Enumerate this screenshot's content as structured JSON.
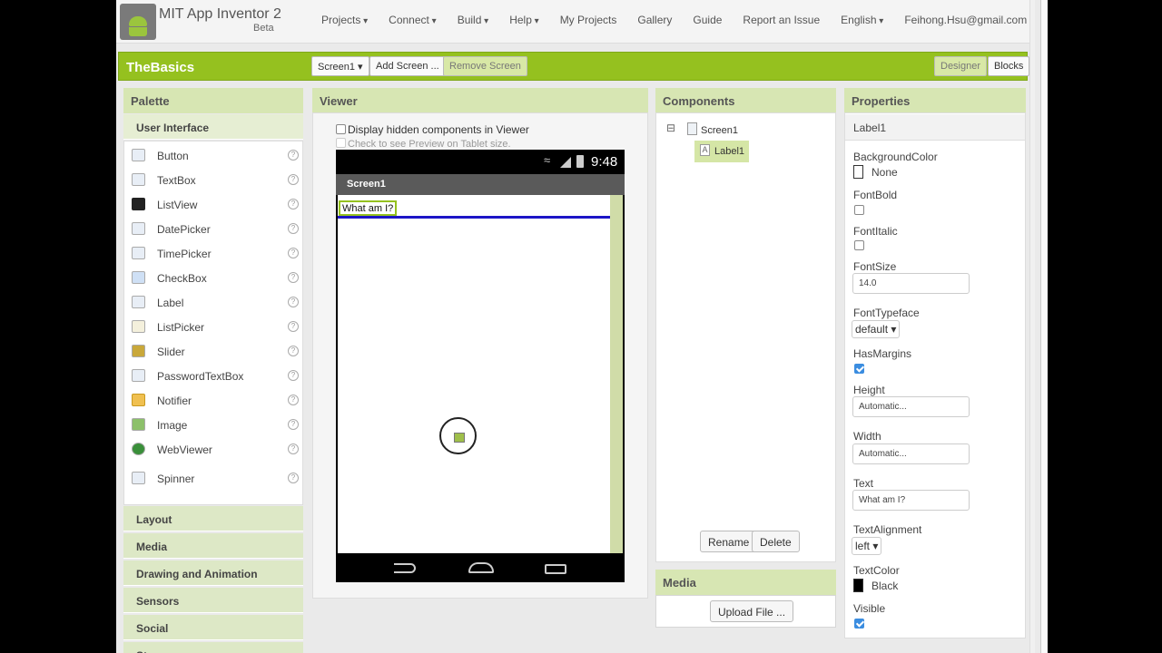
{
  "app": {
    "title": "MIT App Inventor 2",
    "badge": "Beta"
  },
  "nav": [
    "Projects",
    "Connect",
    "Build",
    "Help",
    "My Projects",
    "Gallery",
    "Guide",
    "Report an Issue",
    "English",
    "Feihong.Hsu@gmail.com"
  ],
  "project": {
    "name": "TheBasics",
    "screen_select": "Screen1",
    "add_screen": "Add Screen ...",
    "remove_screen": "Remove Screen",
    "designer": "Designer",
    "blocks": "Blocks"
  },
  "palette": {
    "title": "Palette",
    "section": "User Interface",
    "items": [
      {
        "label": "Button",
        "icon": "button-icon"
      },
      {
        "label": "TextBox",
        "icon": "textbox-icon"
      },
      {
        "label": "ListView",
        "icon": "listview-icon"
      },
      {
        "label": "DatePicker",
        "icon": "datepicker-icon"
      },
      {
        "label": "TimePicker",
        "icon": "timepicker-icon"
      },
      {
        "label": "CheckBox",
        "icon": "checkbox-icon"
      },
      {
        "label": "Label",
        "icon": "label-icon"
      },
      {
        "label": "ListPicker",
        "icon": "listpicker-icon"
      },
      {
        "label": "Slider",
        "icon": "slider-icon"
      },
      {
        "label": "PasswordTextBox",
        "icon": "passwordtextbox-icon"
      },
      {
        "label": "Notifier",
        "icon": "notifier-icon"
      },
      {
        "label": "Image",
        "icon": "image-icon"
      },
      {
        "label": "WebViewer",
        "icon": "webviewer-icon"
      },
      {
        "label": "Spinner",
        "icon": "spinner-icon"
      }
    ],
    "help_glyph": "?",
    "categories": [
      "Layout",
      "Media",
      "Drawing and Animation",
      "Sensors",
      "Social",
      "St"
    ]
  },
  "viewer": {
    "title": "Viewer",
    "show_hidden": "Display hidden components in Viewer",
    "tablet_preview": "Check to see Preview on Tablet size.",
    "time": "9:48",
    "screen_title": "Screen1",
    "label_text": "What am I?"
  },
  "components": {
    "title": "Components",
    "tree_toggle": "⊟",
    "root": "Screen1",
    "child": "Label1",
    "rename": "Rename",
    "delete": "Delete"
  },
  "media": {
    "title": "Media",
    "upload": "Upload File ..."
  },
  "properties": {
    "title": "Properties",
    "component": "Label1",
    "background_color_label": "BackgroundColor",
    "background_color_value": "None",
    "font_bold_label": "FontBold",
    "font_italic_label": "FontItalic",
    "font_size_label": "FontSize",
    "font_size_value": "14.0",
    "font_typeface_label": "FontTypeface",
    "font_typeface_value": "default",
    "has_margins_label": "HasMargins",
    "height_label": "Height",
    "height_value": "Automatic...",
    "width_label": "Width",
    "width_value": "Automatic...",
    "text_label": "Text",
    "text_value": "What am I?",
    "text_alignment_label": "TextAlignment",
    "text_alignment_value": "left",
    "text_color_label": "TextColor",
    "text_color_value": "Black",
    "visible_label": "Visible"
  },
  "colors": {
    "brand_green": "#95c11f",
    "header_green": "#d7e6b3",
    "blue_line": "#1c15c7"
  }
}
